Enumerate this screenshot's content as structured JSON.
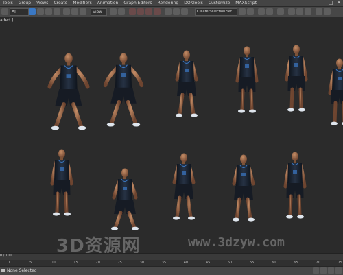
{
  "menubar": {
    "items": [
      "Tools",
      "Group",
      "Views",
      "Create",
      "Modifiers",
      "Animation",
      "Graph Editors",
      "Rendering",
      "DOKTools",
      "Customize",
      "MAXScript"
    ],
    "window_controls": [
      "—",
      "□",
      "✕"
    ]
  },
  "toolbar": {
    "selection_filter": "All",
    "view_dropdown": "View",
    "named_selection_placeholder": "Create Selection Set"
  },
  "viewport": {
    "label": "aded ]",
    "figure_count_row1": 6,
    "figure_count_row2": 5
  },
  "watermark": {
    "brand": "3D资源网",
    "url": "www.3dzyw.com"
  },
  "timeline": {
    "frame_counter": "0 / 100",
    "ticks": [
      "0",
      "5",
      "10",
      "15",
      "20",
      "25",
      "30",
      "35",
      "40",
      "45",
      "50",
      "55",
      "60",
      "65",
      "70",
      "75"
    ]
  },
  "statusbar": {
    "text": "None Selected"
  },
  "colors": {
    "viewport_bg": "#2b2b2b",
    "jersey": "#1b2433",
    "skin": "#9a6a48",
    "accent_blue": "#3a78c4"
  }
}
